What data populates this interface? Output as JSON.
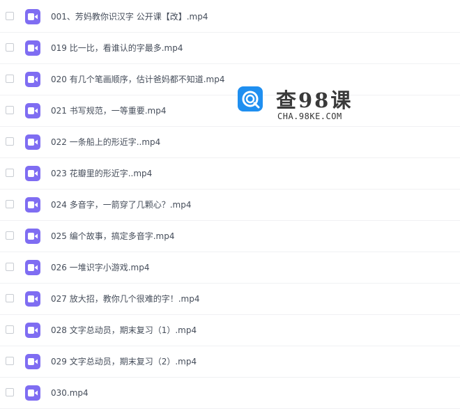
{
  "files": [
    {
      "name": "001、芳妈教你识汉字 公开课【改】.mp4",
      "icon": "video-file-icon"
    },
    {
      "name": "019 比一比，看谁认的字最多.mp4",
      "icon": "video-file-icon"
    },
    {
      "name": "020 有几个笔画顺序，估计爸妈都不知道.mp4",
      "icon": "video-file-icon"
    },
    {
      "name": "021 书写规范，一等重要.mp4",
      "icon": "video-file-icon"
    },
    {
      "name": "022 一条船上的形近字..mp4",
      "icon": "video-file-icon"
    },
    {
      "name": "023 花瓣里的形近字..mp4",
      "icon": "video-file-icon"
    },
    {
      "name": "024 多音字，一箭穿了几颗心？.mp4",
      "icon": "video-file-icon"
    },
    {
      "name": "025 编个故事，搞定多音字.mp4",
      "icon": "video-file-icon"
    },
    {
      "name": "026 一堆识字小游戏.mp4",
      "icon": "video-file-icon"
    },
    {
      "name": "027 放大招，教你几个很难的字！.mp4",
      "icon": "video-file-icon"
    },
    {
      "name": "028 文字总动员，期末复习（1）.mp4",
      "icon": "video-file-icon"
    },
    {
      "name": "029 文字总动员，期末复习（2）.mp4",
      "icon": "video-file-icon"
    },
    {
      "name": "030.mp4",
      "icon": "video-file-icon"
    }
  ],
  "watermark": {
    "title": "查98课",
    "url": "CHA.98KE.COM",
    "icon": "search-logo-icon"
  },
  "colors": {
    "icon_bg": "#7f6df2",
    "logo_blue": "#1f8ff0",
    "text": "#454d5a"
  }
}
